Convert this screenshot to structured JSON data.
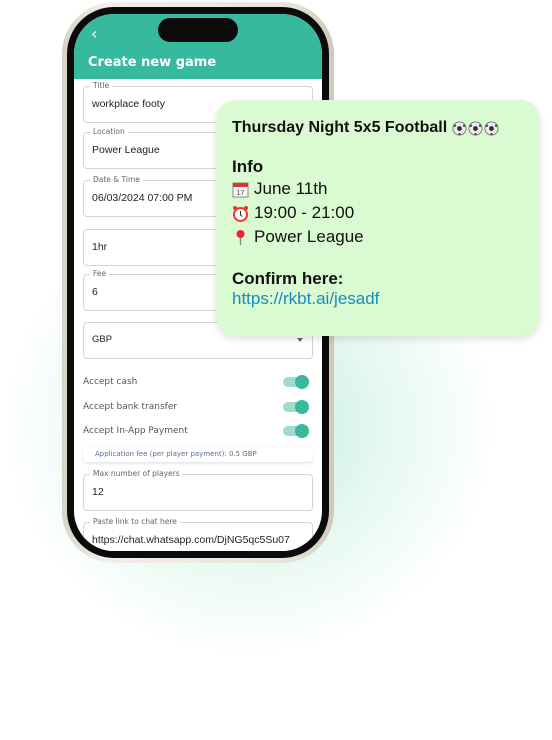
{
  "app": {
    "header_title": "Create new game",
    "back_icon": "chevron-left-icon",
    "accent": "#37b99e"
  },
  "form": {
    "title": {
      "label": "Title",
      "value": "workplace footy"
    },
    "location": {
      "label": "Location",
      "value": "Power League"
    },
    "datetime": {
      "label": "Date & Time",
      "value": "06/03/2024 07:00 PM"
    },
    "duration": {
      "value": "1hr"
    },
    "fee": {
      "label": "Fee",
      "value": "6"
    },
    "currency": {
      "value": "GBP"
    },
    "toggles": [
      {
        "label": "Accept cash",
        "on": true
      },
      {
        "label": "Accept bank transfer",
        "on": true
      },
      {
        "label": "Accept In-App Payment",
        "on": true
      }
    ],
    "app_fee_note": "Application fee (per player payment): 0.5 GBP",
    "max_players": {
      "label": "Max number of players",
      "value": "12"
    },
    "chat_link": {
      "label": "Paste link to chat here",
      "value": "https://chat.whatsapp.com/DjNG5qc5Su07"
    }
  },
  "message": {
    "title": "Thursday Night 5x5 Football",
    "info_heading": "Info",
    "date": "June 11th",
    "time": "19:00 - 21:00",
    "place": "Power League",
    "confirm_heading": "Confirm here:",
    "link": "https://rkbt.ai/jesadf",
    "bg": "#dafad1"
  }
}
